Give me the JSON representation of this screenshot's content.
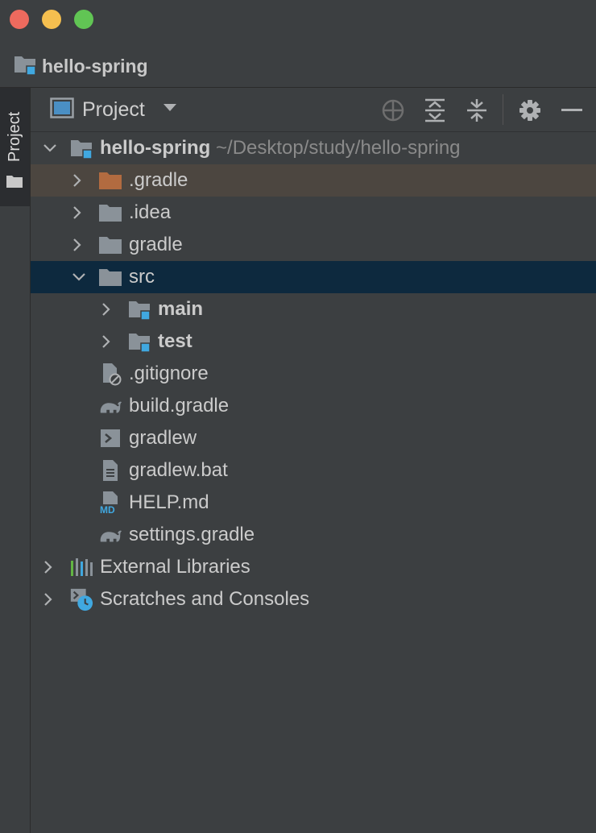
{
  "window": {
    "breadcrumb": "hello-spring"
  },
  "tool_stripe": {
    "label": "Project"
  },
  "toolbar": {
    "view_label": "Project",
    "icons": [
      "crosshair-icon",
      "expand-all-icon",
      "collapse-all-icon",
      "gear-icon",
      "minimize-icon"
    ]
  },
  "tree": {
    "root": {
      "label": "hello-spring",
      "path": "~/Desktop/study/hello-spring"
    },
    "items": [
      {
        "label": ".gradle",
        "icon": "folder-orange-icon"
      },
      {
        "label": ".idea",
        "icon": "folder-icon"
      },
      {
        "label": "gradle",
        "icon": "folder-icon"
      },
      {
        "label": "src",
        "icon": "folder-icon"
      },
      {
        "label": "main",
        "icon": "module-folder-icon"
      },
      {
        "label": "test",
        "icon": "module-folder-icon"
      },
      {
        "label": ".gitignore",
        "icon": "ignored-file-icon"
      },
      {
        "label": "build.gradle",
        "icon": "gradle-elephant-icon"
      },
      {
        "label": "gradlew",
        "icon": "shell-script-icon"
      },
      {
        "label": "gradlew.bat",
        "icon": "text-file-icon"
      },
      {
        "label": "HELP.md",
        "icon": "markdown-file-icon"
      },
      {
        "label": "settings.gradle",
        "icon": "gradle-elephant-icon"
      },
      {
        "label": "External Libraries",
        "icon": "libraries-icon"
      },
      {
        "label": "Scratches and Consoles",
        "icon": "scratches-icon"
      }
    ]
  },
  "colors": {
    "background": "#3c3f41",
    "selection": "#0d293e",
    "modified_highlight": "#4c4640",
    "accent_blue": "#40a8e0",
    "folder_gray": "#8a9299",
    "folder_orange": "#b26b40"
  }
}
